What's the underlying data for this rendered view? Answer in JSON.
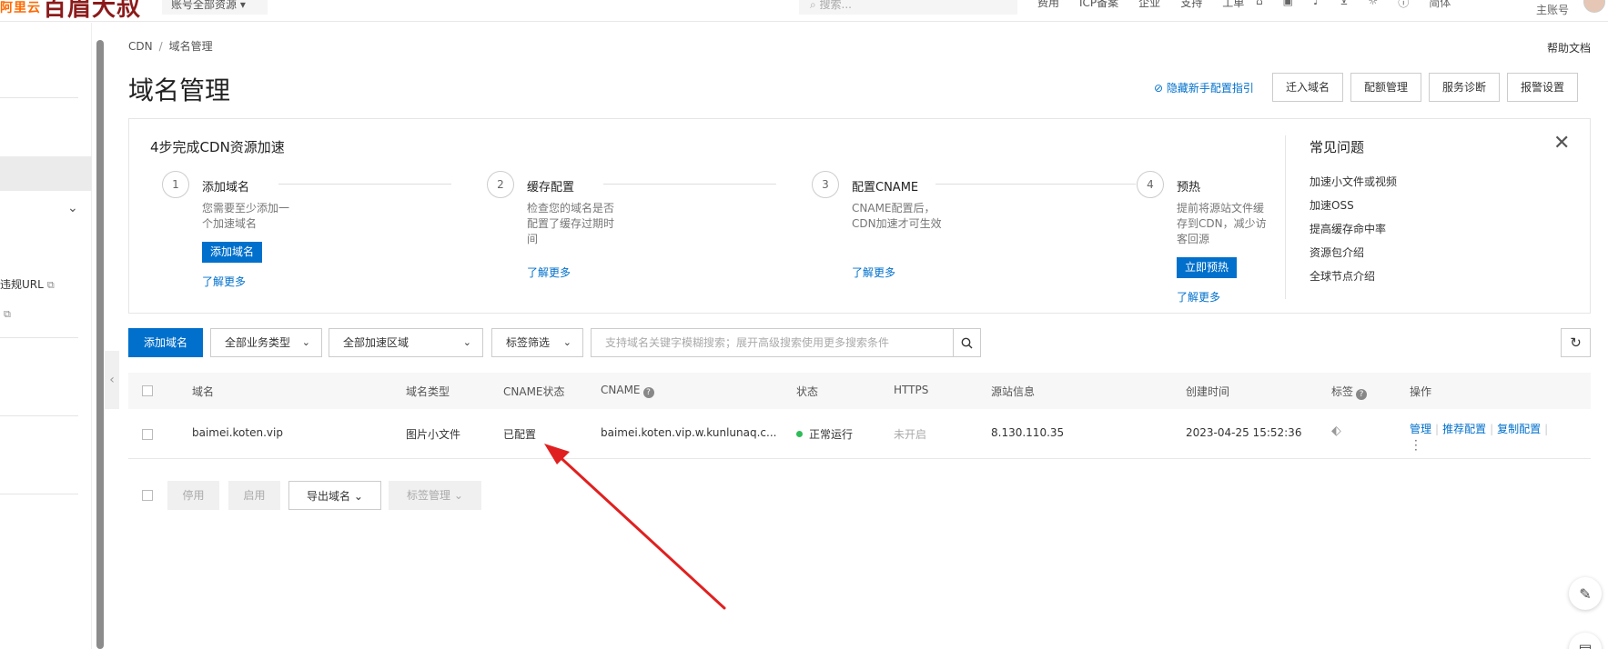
{
  "topbar": {
    "brand": "百眉大叔",
    "brand_prefix": "阿里云",
    "account_scope": "账号全部资源",
    "search_placeholder": "搜索...",
    "menu": [
      "费用",
      "ICP备案",
      "企业",
      "支持",
      "工单"
    ],
    "lang": "简体",
    "sub_account": "主账号"
  },
  "sidebar": {
    "items": [
      {
        "label": "违规URL"
      }
    ]
  },
  "breadcrumb": {
    "root": "CDN",
    "sep": "/",
    "current": "域名管理"
  },
  "help_doc": "帮助文档",
  "page_title": "域名管理",
  "hide_guide": "隐藏新手配置指引",
  "header_buttons": [
    "迁入域名",
    "配额管理",
    "服务诊断",
    "报警设置"
  ],
  "guide": {
    "title": "4步完成CDN资源加速",
    "steps": [
      {
        "num": "1",
        "title": "添加域名",
        "desc": "您需要至少添加一个加速域名",
        "button": "添加域名",
        "link": "了解更多"
      },
      {
        "num": "2",
        "title": "缓存配置",
        "desc": "检查您的域名是否配置了缓存过期时间",
        "link": "了解更多"
      },
      {
        "num": "3",
        "title": "配置CNAME",
        "desc": "CNAME配置后，CDN加速才可生效",
        "link": "了解更多"
      },
      {
        "num": "4",
        "title": "预热",
        "desc": "提前将源站文件缓存到CDN，减少访客回源",
        "button": "立即预热",
        "link": "了解更多"
      }
    ],
    "faq_title": "常见问题",
    "faq": [
      "加速小文件或视频",
      "加速OSS",
      "提高缓存命中率",
      "资源包介绍",
      "全球节点介绍"
    ]
  },
  "toolbar": {
    "add_domain": "添加域名",
    "biz_type": "全部业务类型",
    "region": "全部加速区域",
    "tag_filter": "标签筛选",
    "search_placeholder": "支持域名关键字模糊搜索；展开高级搜索使用更多搜索条件"
  },
  "table": {
    "headers": {
      "domain": "域名",
      "type": "域名类型",
      "cname_status": "CNAME状态",
      "cname": "CNAME",
      "status": "状态",
      "https": "HTTPS",
      "origin": "源站信息",
      "created": "创建时间",
      "tags": "标签",
      "ops": "操作"
    },
    "rows": [
      {
        "domain": "baimei.koten.vip",
        "type": "图片小文件",
        "cname_status": "已配置",
        "cname": "baimei.koten.vip.w.kunlunaq.c...",
        "status": "正常运行",
        "https": "未开启",
        "origin": "8.130.110.35",
        "created": "2023-04-25 15:52:36",
        "ops": [
          "管理",
          "推荐配置",
          "复制配置"
        ]
      }
    ]
  },
  "bottom": {
    "disable": "停用",
    "enable": "启用",
    "export": "导出域名",
    "tag_mgmt": "标签管理"
  },
  "colors": {
    "primary": "#0070cc",
    "annotation_arrow": "#e02020",
    "status_ok": "#2ebc58"
  }
}
